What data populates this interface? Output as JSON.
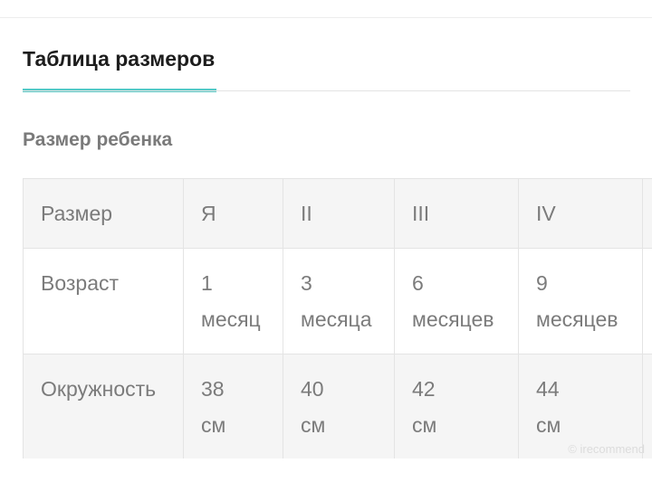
{
  "tabs": [
    {
      "label": "Таблица размеров",
      "active": true
    }
  ],
  "section": {
    "title": "Размер ребенка"
  },
  "size_table": {
    "rows": [
      {
        "label": "Размер",
        "cells": [
          "Я",
          "II",
          "III",
          "IV"
        ]
      },
      {
        "label": "Возраст",
        "cells": [
          "1\nмесяц",
          "3\nмесяца",
          "6\nмесяцев",
          "9\nмесяцев"
        ]
      },
      {
        "label": "Окружность",
        "cells": [
          "38\nсм",
          "40\nсм",
          "42\nсм",
          "44\nсм"
        ]
      }
    ]
  },
  "watermark": "© irecommend",
  "colors": {
    "accent": "#55c9c7",
    "heading": "#1d1d1d",
    "muted_text": "#7b7b7b",
    "row_shade": "#f5f5f5",
    "border": "#e4e4e4"
  }
}
